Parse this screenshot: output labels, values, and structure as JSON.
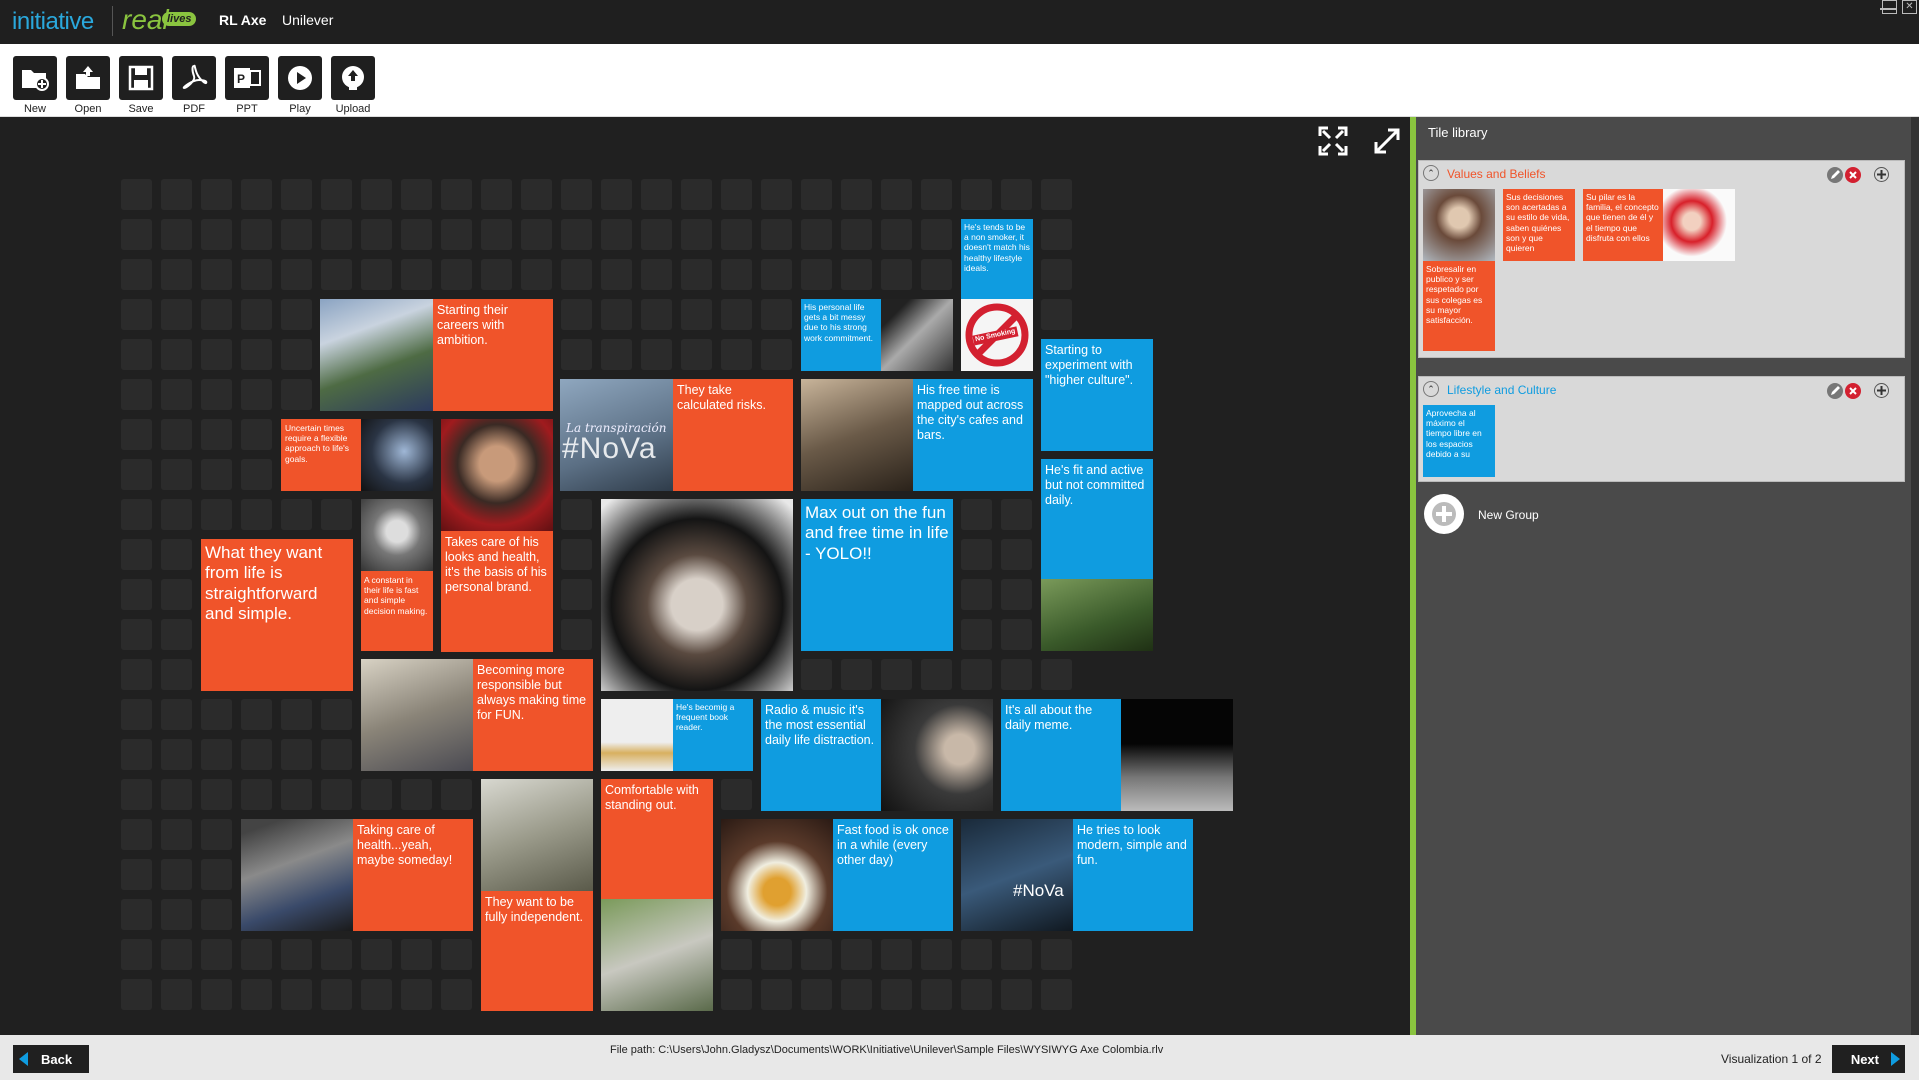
{
  "header": {
    "brand_initiative": "initiative",
    "brand_real": "real",
    "brand_lives": "lives",
    "project": "RL Axe",
    "client": "Unilever"
  },
  "toolbar": [
    {
      "label": "New",
      "icon": "new-folder-icon"
    },
    {
      "label": "Open",
      "icon": "open-icon"
    },
    {
      "label": "Save",
      "icon": "save-icon"
    },
    {
      "label": "PDF",
      "icon": "pdf-icon"
    },
    {
      "label": "PPT",
      "icon": "ppt-icon"
    },
    {
      "label": "Play",
      "icon": "play-icon"
    },
    {
      "label": "Upload",
      "icon": "upload-icon"
    }
  ],
  "colors": {
    "orange": "#f0542a",
    "blue": "#0f9ce0",
    "green": "#8ac43f"
  },
  "tiles": {
    "starting_careers": "Starting their careers with ambition.",
    "calculated_risks": "They take calculated risks.",
    "nova_script": "La transpiración",
    "nova": "#NoVa",
    "uncertain_times": "Uncertain times require a flexible approach to life's goals.",
    "constant_life": "A constant in their life is fast and simple decision making.",
    "looks_health": "Takes care of his looks and health, it's the basis of his personal brand.",
    "what_they_want": "What they want from life is straightforward and simple.",
    "personal_life": "His personal life gets a bit messy due to his strong work commitment.",
    "non_smoker": "He's tends to be a non smoker, it doesn't match his healthy lifestyle ideals.",
    "no_smoking": "No Smoking",
    "free_time": "His free time is mapped out across the city's cafes and bars.",
    "higher_culture": "Starting to experiment with \"higher culture\".",
    "max_out": "Max out on the fun and free time in life - YOLO!!",
    "fit_active": "He's fit and active but not committed daily.",
    "responsible": "Becoming more responsible but always making time for FUN.",
    "book_reader": "He's becomig a frequent book reader.",
    "radio_music": "Radio & music it's the most essential daily life distraction.",
    "daily_meme": "It's all about the daily meme.",
    "health_someday": "Taking care of health...yeah, maybe someday!",
    "independent": "They want to be fully independent.",
    "standing_out": "Comfortable with standing out.",
    "fast_food": "Fast food is ok once in a while (every other day)",
    "modern_simple": "He tries to look modern, simple and fun.",
    "nova2": "#NoVa"
  },
  "library": {
    "title": "Tile library",
    "groups": [
      {
        "name": "Values and Beliefs",
        "tiles": [
          "Sobresalir en publico y ser respetado por sus colegas es su mayor satisfacción.",
          "Sus decisiones son acertadas a su estilo de vida, saben quiénes son y que quieren",
          "Su pilar es la familia, el concepto que tienen de él y el tiempo que disfruta con ellos"
        ]
      },
      {
        "name": "Lifestyle and Culture",
        "tiles": [
          "Aprovecha al máximo el tiempo libre en los espacios debido a su"
        ]
      }
    ],
    "new_group": "New Group"
  },
  "footer": {
    "back": "Back",
    "file_path": "File path: C:\\Users\\John.Gladysz\\Documents\\WORK\\Initiative\\Unilever\\Sample Files\\WYSIWYG Axe Colombia.rlv",
    "visualization": "Visualization 1 of 2",
    "next": "Next"
  }
}
